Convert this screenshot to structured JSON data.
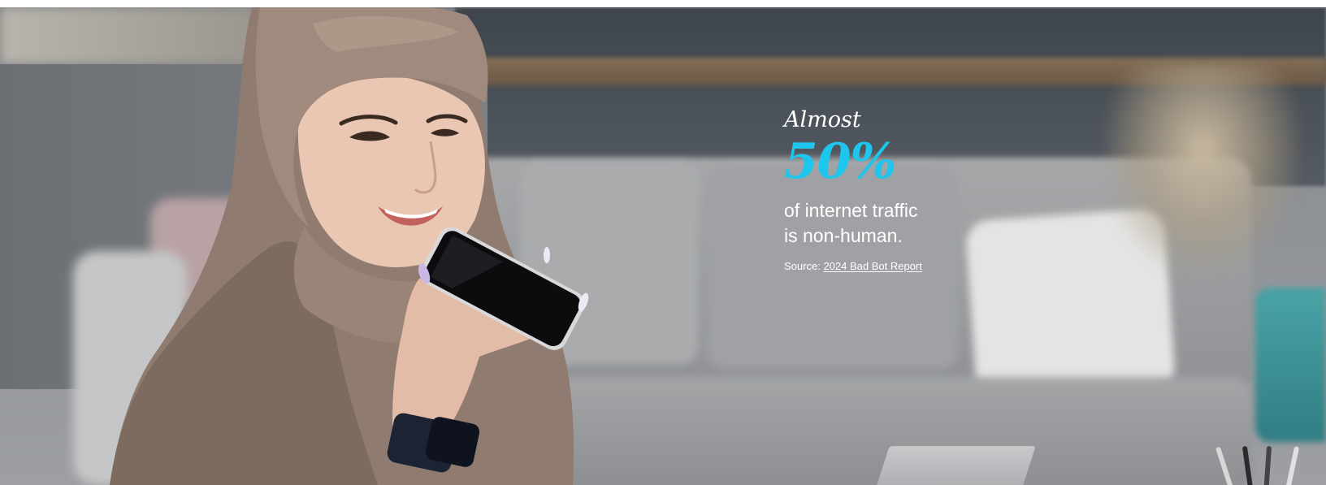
{
  "hero": {
    "stat": {
      "eyebrow": "Almost",
      "figure": "50%",
      "description": "of internet traffic is non-human.",
      "source_prefix": "Source:",
      "source_link": "2024 Bad Bot Report"
    },
    "accent_color": "#1ec6ee",
    "image": "woman-in-hijab-speaking-into-phone"
  }
}
